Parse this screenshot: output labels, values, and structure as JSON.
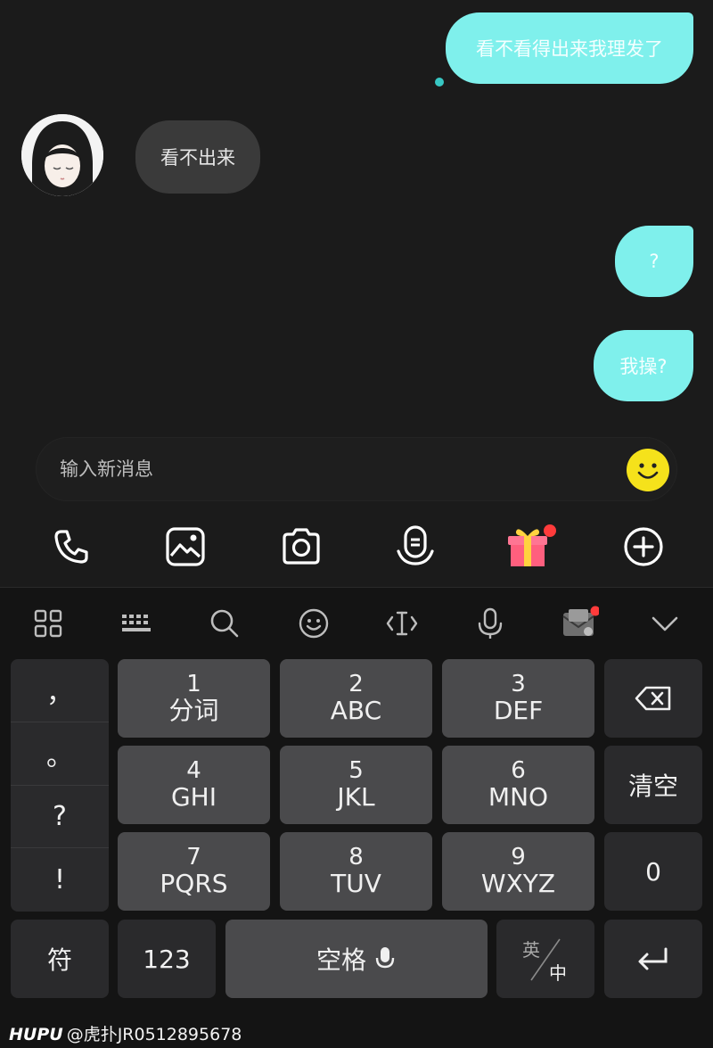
{
  "messages": [
    {
      "side": "me",
      "text": "看不看得出来我理发了"
    },
    {
      "side": "other",
      "text": "看不出来"
    },
    {
      "side": "me",
      "text": "?"
    },
    {
      "side": "me",
      "text": "我操?"
    }
  ],
  "input": {
    "placeholder": "输入新消息"
  },
  "tools": [
    "phone-icon",
    "image-icon",
    "camera-icon",
    "voice-message-icon",
    "gift-icon",
    "add-icon"
  ],
  "keyboard": {
    "toolbar": [
      "grid-icon",
      "keyboard-icon",
      "search-icon",
      "emoji-icon",
      "cursor-icon",
      "microphone-icon",
      "mail-icon",
      "chevron-down-icon"
    ],
    "punctuation": [
      "，",
      "。",
      "?",
      "!"
    ],
    "keys": {
      "k1": {
        "num": "1",
        "letters": "分词"
      },
      "k2": {
        "num": "2",
        "letters": "ABC"
      },
      "k3": {
        "num": "3",
        "letters": "DEF"
      },
      "k4": {
        "num": "4",
        "letters": "GHI"
      },
      "k5": {
        "num": "5",
        "letters": "JKL"
      },
      "k6": {
        "num": "6",
        "letters": "MNO"
      },
      "k7": {
        "num": "7",
        "letters": "PQRS"
      },
      "k8": {
        "num": "8",
        "letters": "TUV"
      },
      "k9": {
        "num": "9",
        "letters": "WXYZ"
      }
    },
    "clear": "清空",
    "zero": "0",
    "symbols": "符",
    "numbers": "123",
    "space": "空格",
    "lang_top": "英",
    "lang_bottom": "中"
  },
  "watermark": {
    "brand": "HUPU",
    "text": "@虎扑JR0512895678"
  },
  "colors": {
    "my_bubble": "#7ff0ec",
    "other_bubble": "#3a3a3a",
    "accent_dot": "#38c8c4",
    "gift": "#ff4b6e",
    "badge": "#ff3b3b"
  }
}
